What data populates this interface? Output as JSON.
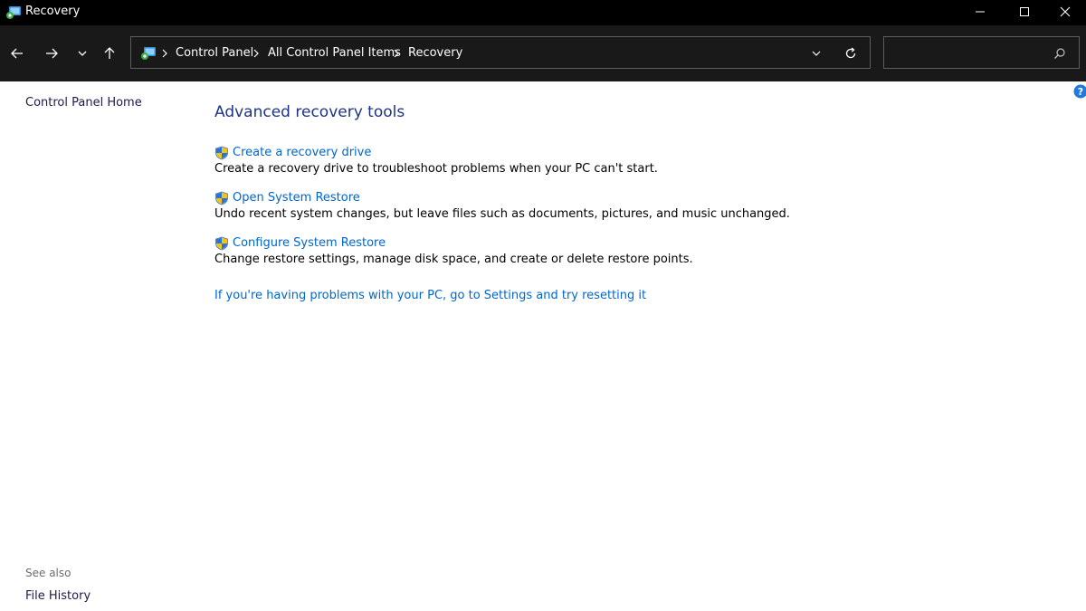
{
  "window": {
    "title": "Recovery",
    "controls": [
      "minimize-icon",
      "maximize-icon",
      "close-icon"
    ]
  },
  "navigation": {
    "buttons": [
      "back-arrow-icon",
      "forward-arrow-icon",
      "chevron-down-icon",
      "up-arrow-icon"
    ],
    "breadcrumb": [
      "Control Panel",
      "All Control Panel Items",
      "Recovery"
    ],
    "search": {
      "value": "",
      "placeholder": ""
    }
  },
  "sidebar": {
    "home_link": "Control Panel Home",
    "see_also_heading": "See also",
    "see_also_links": [
      "File History"
    ]
  },
  "main": {
    "section_title": "Advanced recovery tools",
    "tasks": [
      {
        "label": "Create a recovery drive",
        "description": "Create a recovery drive to troubleshoot problems when your PC can't start."
      },
      {
        "label": "Open System Restore",
        "description": "Undo recent system changes, but leave files such as documents, pictures, and music unchanged."
      },
      {
        "label": "Configure System Restore",
        "description": "Change restore settings, manage disk space, and create or delete restore points."
      }
    ],
    "reset_link": "If you're having problems with your PC, go to Settings and try resetting it"
  },
  "colors": {
    "titlebar_bg": "#000000",
    "navbar_bg": "#191919",
    "link_blue": "#0066cc",
    "heading_blue": "#1e3287",
    "sidebar_text": "#1b1b4b"
  }
}
